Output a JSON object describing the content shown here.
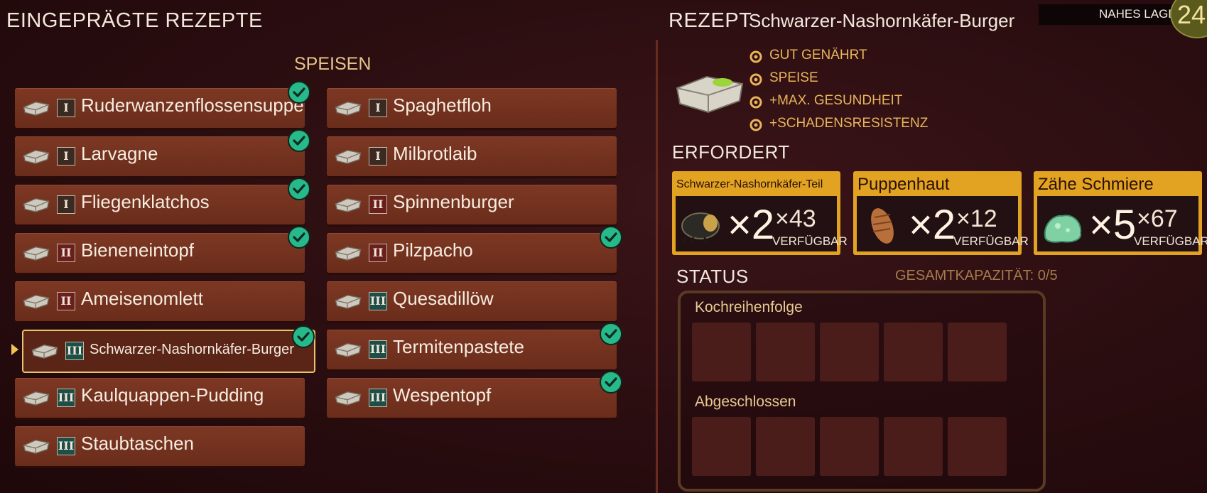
{
  "left_panel": {
    "title": "EINGEPRÄGTE REZEPTE",
    "category": "SPEISEN",
    "recipes": [
      {
        "name": "Ruderwanzenflossensuppe",
        "tier": "I",
        "learned": true
      },
      {
        "name": "Spaghetfloh",
        "tier": "I",
        "learned": false
      },
      {
        "name": "Larvagne",
        "tier": "I",
        "learned": true
      },
      {
        "name": "Milbrotlaib",
        "tier": "I",
        "learned": false
      },
      {
        "name": "Fliegenklatchos",
        "tier": "I",
        "learned": true
      },
      {
        "name": "Spinnenburger",
        "tier": "II",
        "learned": false
      },
      {
        "name": "Bieneneintopf",
        "tier": "II",
        "learned": true
      },
      {
        "name": "Pilzpacho",
        "tier": "II",
        "learned": true
      },
      {
        "name": "Ameisenomlett",
        "tier": "II",
        "learned": false
      },
      {
        "name": "Quesadillöw",
        "tier": "III",
        "learned": false
      },
      {
        "name": "Schwarzer-Nashornkäfer-Burger",
        "tier": "III",
        "learned": true,
        "selected": true
      },
      {
        "name": "Termitenpastete",
        "tier": "III",
        "learned": true
      },
      {
        "name": "Kaulquappen-Pudding",
        "tier": "III",
        "learned": false
      },
      {
        "name": "Wespentopf",
        "tier": "III",
        "learned": true
      },
      {
        "name": "Staubtaschen",
        "tier": "III",
        "learned": false
      }
    ]
  },
  "right_panel": {
    "recipe_label": "REZEPT",
    "recipe_name": "Schwarzer-Nashornkäfer-Burger",
    "nearby_storage_label": "NAHES LAGER",
    "nearby_storage_count": "24",
    "tags": [
      {
        "icon": "heart-food-icon",
        "label": "GUT GENÄHRT"
      },
      {
        "icon": "food-icon",
        "label": "SPEISE"
      },
      {
        "icon": "health-gear-icon",
        "label": "+MAX. GESUNDHEIT"
      },
      {
        "icon": "shield-hand-icon",
        "label": "+SCHADENSRESISTENZ"
      }
    ],
    "required_label": "ERFORDERT",
    "requirements": [
      {
        "name": "Schwarzer-Nashornkäfer-Teil",
        "required": "×2",
        "available": "×43",
        "available_label": "VERFÜGBAR",
        "icon": "beetle-part-icon"
      },
      {
        "name": "Puppenhaut",
        "required": "×2",
        "available": "×12",
        "available_label": "VERFÜGBAR",
        "icon": "pupa-skin-icon"
      },
      {
        "name": "Zähe Schmiere",
        "required": "×5",
        "available": "×67",
        "available_label": "VERFÜGBAR",
        "icon": "slime-icon"
      }
    ],
    "status_label": "STATUS",
    "capacity_label": "GESAMTKAPAZITÄT: 0/5",
    "queue_label": "Kochreihenfolge",
    "completed_label": "Abgeschlossen"
  },
  "colors": {
    "accent": "#e3a322",
    "recipe_bg": "#7d3823",
    "check": "#27b98a",
    "background": "#2a0d10"
  }
}
